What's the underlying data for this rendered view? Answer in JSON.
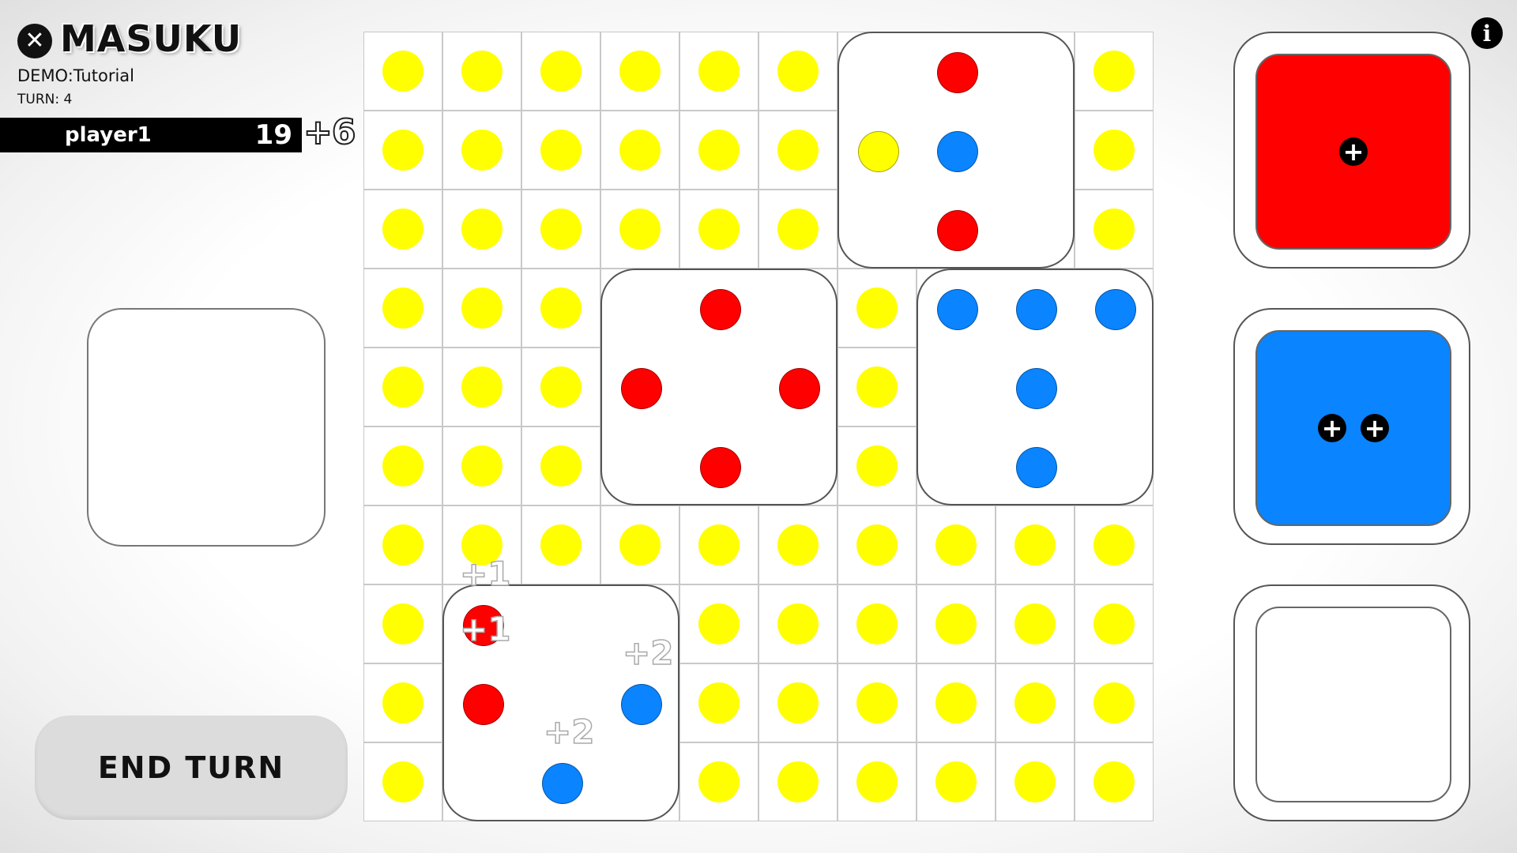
{
  "header": {
    "close_glyph": "✕",
    "title": "MASUKU",
    "mode": "DEMO:Tutorial",
    "turn": "TURN: 4"
  },
  "player": {
    "name": "player1",
    "score": "19",
    "gain": "+6"
  },
  "controls": {
    "end_turn": "END TURN",
    "info_glyph": "i"
  },
  "colors": {
    "yellow": "#ffff00",
    "red": "#ff0000",
    "blue": "#0a84ff"
  },
  "board": {
    "grid_size": 10,
    "tiles": [
      {
        "id": "tile-top",
        "row": 0,
        "col": 6,
        "pips": [
          {
            "r": 0,
            "c": 1,
            "color": "red"
          },
          {
            "r": 1,
            "c": 0,
            "color": "yellow"
          },
          {
            "r": 1,
            "c": 1,
            "color": "blue"
          },
          {
            "r": 2,
            "c": 1,
            "color": "red"
          }
        ]
      },
      {
        "id": "tile-middle-left",
        "row": 3,
        "col": 3,
        "pips": [
          {
            "r": 0,
            "c": 1,
            "color": "red"
          },
          {
            "r": 1,
            "c": 0,
            "color": "red"
          },
          {
            "r": 1,
            "c": 2,
            "color": "red"
          },
          {
            "r": 2,
            "c": 1,
            "color": "red"
          }
        ]
      },
      {
        "id": "tile-middle-right",
        "row": 3,
        "col": 7,
        "pips": [
          {
            "r": 0,
            "c": 0,
            "color": "blue"
          },
          {
            "r": 0,
            "c": 1,
            "color": "blue"
          },
          {
            "r": 0,
            "c": 2,
            "color": "blue"
          },
          {
            "r": 1,
            "c": 1,
            "color": "blue"
          },
          {
            "r": 2,
            "c": 1,
            "color": "blue"
          }
        ]
      },
      {
        "id": "tile-bottom",
        "row": 7,
        "col": 1,
        "pips": [
          {
            "r": 0,
            "c": 0,
            "color": "red"
          },
          {
            "r": 1,
            "c": 0,
            "color": "red"
          },
          {
            "r": 1,
            "c": 2,
            "color": "blue"
          },
          {
            "r": 2,
            "c": 1,
            "color": "blue"
          }
        ]
      }
    ],
    "score_popups": [
      {
        "text": "+1",
        "row": 7,
        "col": 1,
        "anchor": "top"
      },
      {
        "text": "+1",
        "row": 7,
        "col": 1,
        "anchor": "mid"
      },
      {
        "text": "+2",
        "row": 8,
        "col": 3,
        "anchor": "top"
      },
      {
        "text": "+2",
        "row": 9,
        "col": 2,
        "anchor": "top"
      }
    ]
  },
  "hand": [
    {
      "id": "die-red",
      "color": "red",
      "plus_count": 1
    },
    {
      "id": "die-blue",
      "color": "blue",
      "plus_count": 2
    },
    {
      "id": "die-empty",
      "color": "empty",
      "plus_count": 0
    }
  ]
}
